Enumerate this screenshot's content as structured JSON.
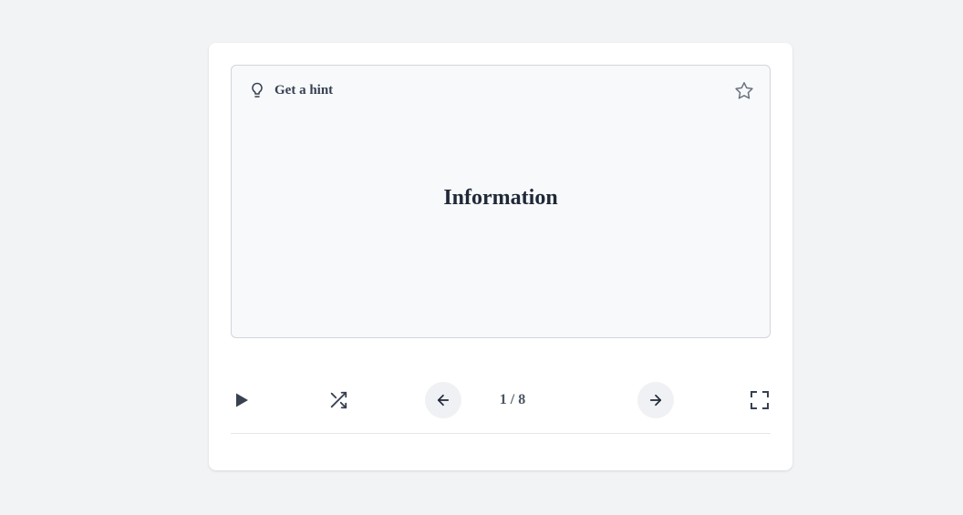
{
  "card": {
    "hint_label": "Get a hint",
    "term": "Information"
  },
  "controls": {
    "counter": "1 / 8"
  },
  "icons": {
    "hint": "lightbulb-icon",
    "favorite": "star-icon",
    "play": "play-icon",
    "shuffle": "shuffle-icon",
    "previous": "arrow-left-icon",
    "next": "arrow-right-icon",
    "fullscreen": "fullscreen-icon"
  },
  "colors": {
    "page_bg": "#f2f3f5",
    "panel_bg": "#ffffff",
    "card_bg": "#f8f9fb",
    "icon": "#374151",
    "button_bg": "#f0f1f4"
  }
}
